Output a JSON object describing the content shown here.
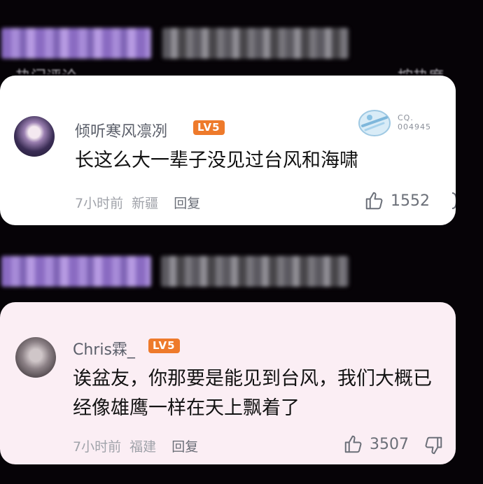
{
  "comments": [
    {
      "username": "倾听寒风凛冽",
      "level": "LV5",
      "text": "长这么大一辈子没见过台风和海啸",
      "time": "7小时前",
      "location": "新疆",
      "reply_label": "回复",
      "likes": "1552",
      "fan_badge": {
        "line1": "CQ.",
        "line2": "004945"
      }
    },
    {
      "username": "Chris霖_",
      "level": "LV5",
      "text_line1": "诶盆友，你那要是能见到台风，我们大概已",
      "text_line2": "经像雄鹰一样在天上飘着了",
      "time": "7小时前",
      "location": "福建",
      "reply_label": "回复",
      "likes": "3507"
    }
  ],
  "colors": {
    "background": "#060307",
    "card1": "#ffffff",
    "card2": "#fbeef4",
    "level_badge": "#ee7a2b"
  }
}
